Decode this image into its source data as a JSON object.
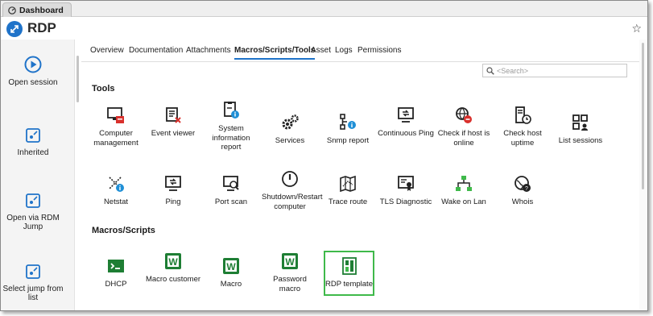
{
  "window": {
    "tab_label": "Dashboard"
  },
  "header": {
    "title": "RDP",
    "favorite_icon": "star-icon"
  },
  "sidebar": {
    "items": [
      {
        "label": "Open session",
        "icon": "play-circle-icon"
      },
      {
        "label": "Inherited",
        "icon": "session-icon"
      },
      {
        "label": "Open via RDM Jump",
        "icon": "session-icon"
      },
      {
        "label": "Select jump from list",
        "icon": "session-icon"
      }
    ]
  },
  "tabs": [
    {
      "label": "Overview"
    },
    {
      "label": "Documentation"
    },
    {
      "label": "Attachments"
    },
    {
      "label": "Macros/Scripts/Tools",
      "active": true
    },
    {
      "label": "Asset"
    },
    {
      "label": "Logs"
    },
    {
      "label": "Permissions"
    }
  ],
  "search": {
    "placeholder": "<Search>"
  },
  "tools": {
    "title": "Tools",
    "items": [
      {
        "label": "Computer management"
      },
      {
        "label": "Event viewer"
      },
      {
        "label": "System information report"
      },
      {
        "label": "Services"
      },
      {
        "label": "Snmp report"
      },
      {
        "label": "Continuous Ping"
      },
      {
        "label": "Check if host is online"
      },
      {
        "label": "Check host uptime"
      },
      {
        "label": "List sessions"
      },
      {
        "label": "Netstat"
      },
      {
        "label": "Ping"
      },
      {
        "label": "Port scan"
      },
      {
        "label": "Shutdown/Restart computer"
      },
      {
        "label": "Trace route"
      },
      {
        "label": "TLS Diagnostic"
      },
      {
        "label": "Wake on Lan"
      },
      {
        "label": "Whois"
      }
    ]
  },
  "macros": {
    "title": "Macros/Scripts",
    "items": [
      {
        "label": "DHCP"
      },
      {
        "label": "Macro customer"
      },
      {
        "label": "Macro"
      },
      {
        "label": "Password macro"
      },
      {
        "label": "RDP template",
        "selected": true
      }
    ]
  },
  "colors": {
    "accent": "#1f73c9",
    "selection": "#3fb94a",
    "macro_green": "#1e7e34",
    "alert_red": "#d9302c"
  }
}
